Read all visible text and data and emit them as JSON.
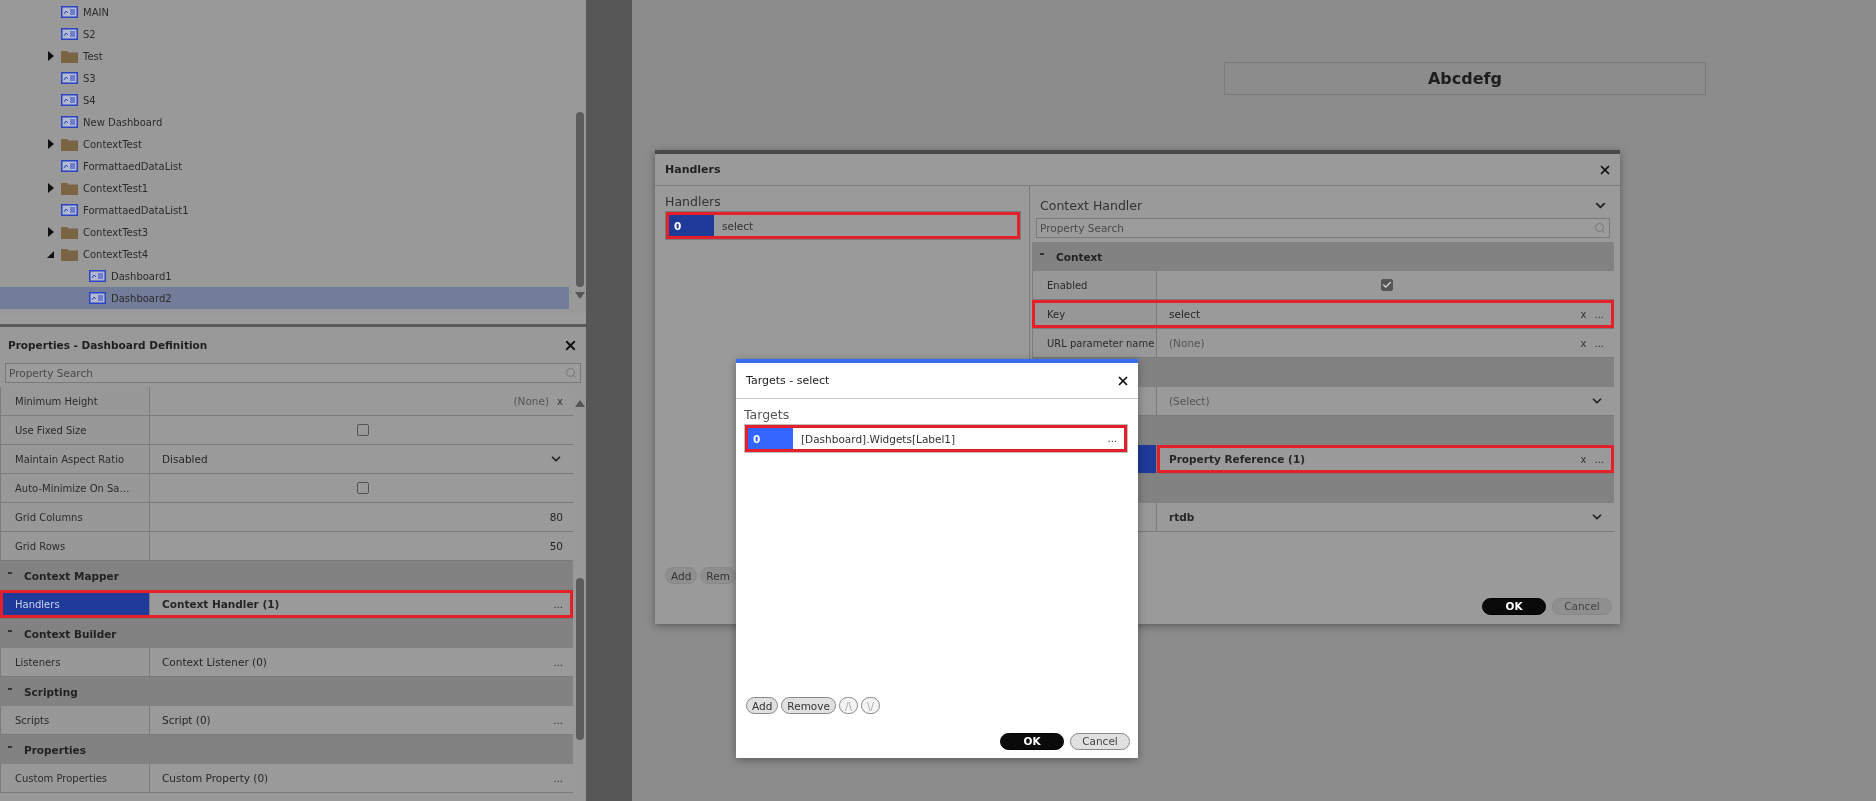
{
  "tree": {
    "items": [
      {
        "kind": "dashboard",
        "label": "MAIN",
        "selected": false
      },
      {
        "kind": "dashboard",
        "label": "S2",
        "selected": false
      },
      {
        "kind": "folder",
        "label": "Test",
        "selected": false,
        "expanded": false
      },
      {
        "kind": "dashboard",
        "label": "S3",
        "selected": false
      },
      {
        "kind": "dashboard",
        "label": "S4",
        "selected": false
      },
      {
        "kind": "dashboard",
        "label": "New Dashboard",
        "selected": false
      },
      {
        "kind": "folder",
        "label": "ContextTest",
        "selected": false,
        "expanded": false
      },
      {
        "kind": "dashboard",
        "label": "FormattaedDataList",
        "selected": false
      },
      {
        "kind": "folder",
        "label": "ContextTest1",
        "selected": false,
        "expanded": false
      },
      {
        "kind": "dashboard",
        "label": "FormattaedDataList1",
        "selected": false
      },
      {
        "kind": "folder",
        "label": "ContextTest3",
        "selected": false,
        "expanded": false
      },
      {
        "kind": "folder",
        "label": "ContextTest4",
        "selected": false,
        "expanded": true,
        "children": [
          {
            "kind": "dashboard",
            "label": "Dashboard1",
            "selected": false
          },
          {
            "kind": "dashboard",
            "label": "Dashboard2",
            "selected": true
          }
        ]
      }
    ]
  },
  "properties": {
    "title": "Properties - Dashboard Definition",
    "search": {
      "placeholder": "Property Search"
    },
    "rows": [
      {
        "kind": "number",
        "label": "Minimum Height",
        "value": "(None)",
        "muted": true,
        "clear": "x",
        "selected": false,
        "highlighted": false
      },
      {
        "kind": "checkbox",
        "label": "Use Fixed Size",
        "checked": false,
        "selected": false,
        "highlighted": false
      },
      {
        "kind": "dropdown",
        "label": "Maintain Aspect Ratio",
        "value": "Disabled",
        "muted": false,
        "bold": false,
        "selected": false,
        "highlighted": false
      },
      {
        "kind": "checkbox",
        "label": "Auto-Minimize On Sa…",
        "checked": false,
        "selected": false,
        "highlighted": false
      },
      {
        "kind": "number",
        "label": "Grid Columns",
        "value": "80",
        "muted": false,
        "selected": false,
        "highlighted": false
      },
      {
        "kind": "number",
        "label": "Grid Rows",
        "value": "50",
        "muted": false,
        "selected": false,
        "highlighted": false
      },
      {
        "kind": "section",
        "title": "Context Mapper",
        "expanded": true
      },
      {
        "kind": "collection",
        "label": "Handlers",
        "value": "Context Handler (1)",
        "bold": true,
        "more": "...",
        "selected": true,
        "highlighted": true
      },
      {
        "kind": "section",
        "title": "Context Builder",
        "expanded": true
      },
      {
        "kind": "collection",
        "label": "Listeners",
        "value": "Context Listener (0)",
        "bold": false,
        "more": "...",
        "selected": false,
        "highlighted": false
      },
      {
        "kind": "section",
        "title": "Scripting",
        "expanded": true
      },
      {
        "kind": "collection",
        "label": "Scripts",
        "value": "Script (0)",
        "bold": false,
        "more": "...",
        "selected": false,
        "highlighted": false
      },
      {
        "kind": "section",
        "title": "Properties",
        "expanded": true
      },
      {
        "kind": "collection",
        "label": "Custom Properties",
        "value": "Custom Property (0)",
        "bold": false,
        "more": "...",
        "selected": false,
        "highlighted": false
      }
    ]
  },
  "canvas": {
    "label_widget": "Abcdefg"
  },
  "handlers_dialog": {
    "title": "Handlers",
    "list_title": "Handlers",
    "items": [
      {
        "index": "0",
        "label": "select",
        "selected": true,
        "highlighted": true
      }
    ],
    "list_buttons": [
      {
        "label": "Add",
        "disabled": false
      },
      {
        "label": "Rem",
        "disabled": false
      }
    ],
    "editor": {
      "title": "Context Handler",
      "search": {
        "placeholder": "Property Search"
      },
      "rows": [
        {
          "kind": "section",
          "title": "Context",
          "expanded": true
        },
        {
          "kind": "checkbox",
          "label": "Enabled",
          "checked": true,
          "selected": false,
          "highlighted": false
        },
        {
          "kind": "text",
          "label": "Key",
          "value": "select",
          "muted": false,
          "clear": "x",
          "more": "...",
          "selected": false,
          "highlighted": true
        },
        {
          "kind": "text",
          "label": "URL parameter name",
          "value": "(None)",
          "muted": true,
          "clear": "x",
          "more": "...",
          "selected": false,
          "highlighted": false
        },
        {
          "kind": "section"
        },
        {
          "kind": "dropdown",
          "value": "(Select)",
          "muted": true,
          "bold": false,
          "selected": false,
          "highlighted": false
        },
        {
          "kind": "section"
        },
        {
          "kind": "collection",
          "value": "Property Reference (1)",
          "bold": true,
          "clear": "x",
          "more": "...",
          "selected": true,
          "highlighted": false,
          "value_highlighted": true
        },
        {
          "kind": "section"
        },
        {
          "kind": "dropdown",
          "value": "rtdb",
          "muted": false,
          "bold": true,
          "selected": false,
          "highlighted": false
        }
      ]
    },
    "buttons": [
      {
        "label": "OK",
        "kind": "primary"
      },
      {
        "label": "Cancel",
        "kind": "secondary"
      }
    ]
  },
  "targets_dialog": {
    "title": "Targets - select",
    "list_title": "Targets",
    "items": [
      {
        "index": "0",
        "label": "[Dashboard].Widgets[Label1]",
        "more": "...",
        "selected": true,
        "highlighted": true
      }
    ],
    "list_buttons": [
      {
        "label": "Add",
        "disabled": false
      },
      {
        "label": "Remove",
        "disabled": false
      },
      {
        "label": "/\\",
        "disabled": true
      },
      {
        "label": "\\/",
        "disabled": true
      }
    ],
    "buttons": [
      {
        "label": "OK",
        "kind": "primary"
      },
      {
        "label": "Cancel",
        "kind": "secondary"
      }
    ]
  }
}
